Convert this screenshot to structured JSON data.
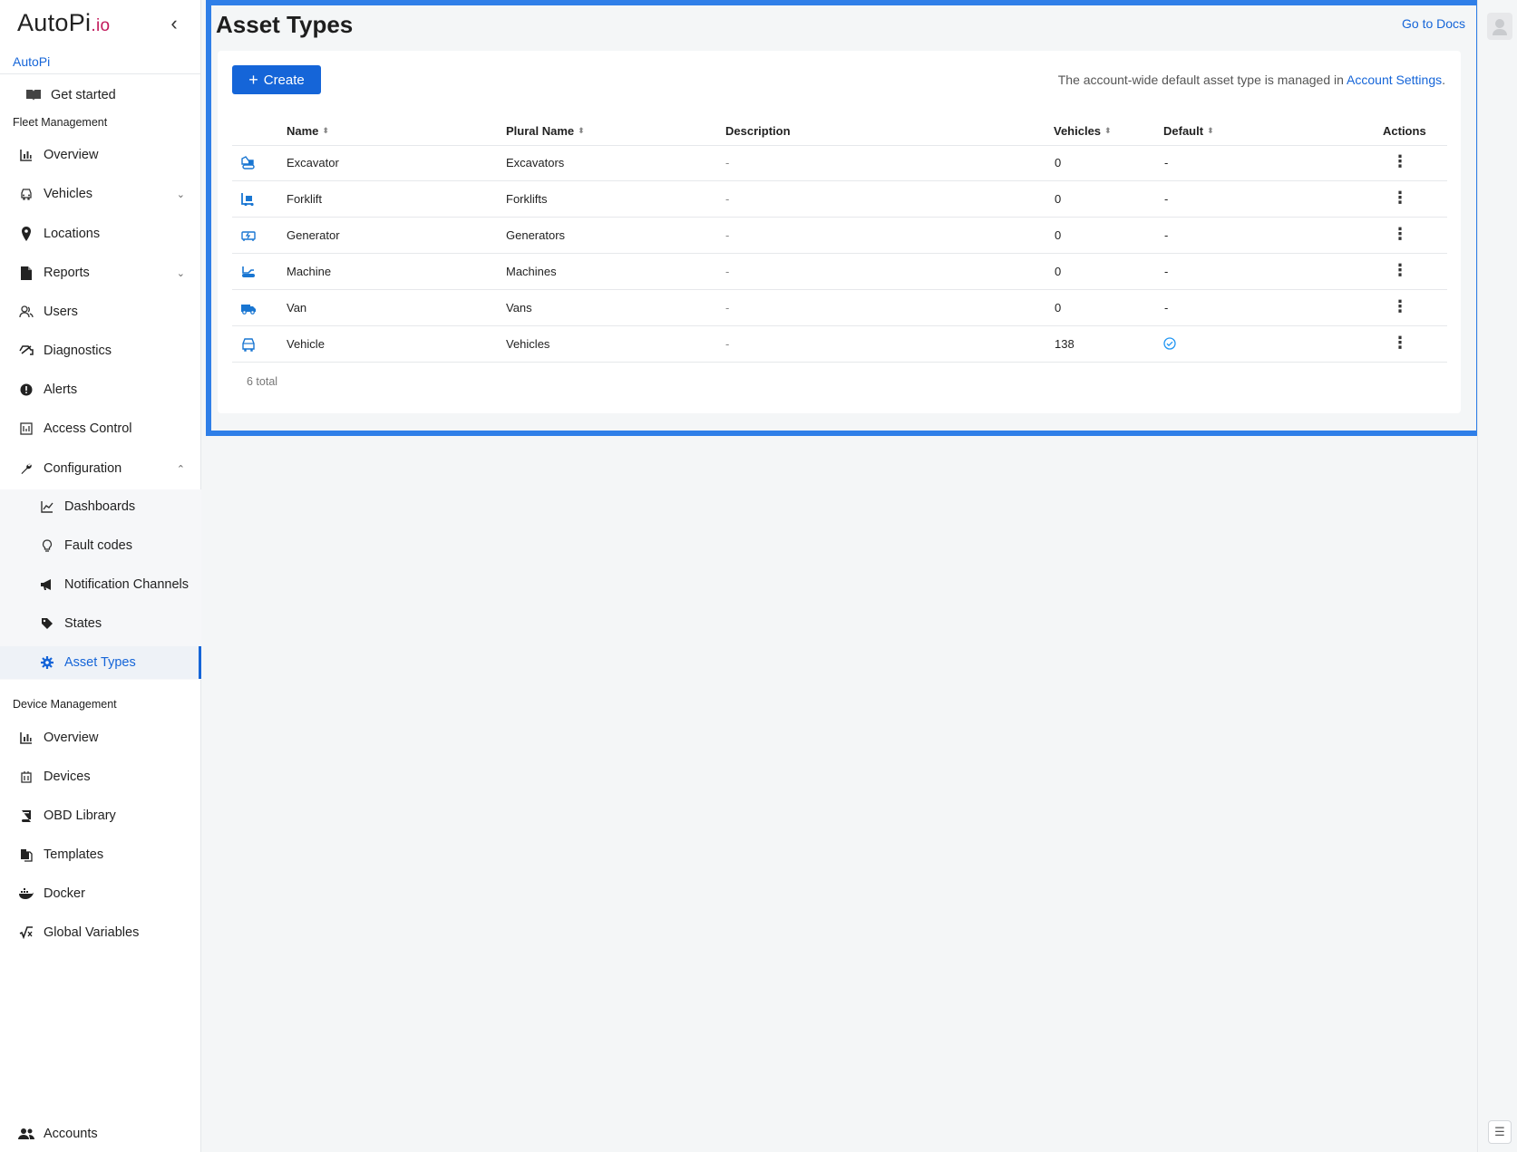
{
  "brand": {
    "name": "AutoPi",
    "suffix": ".io"
  },
  "sidebar": {
    "account": "AutoPi",
    "get_started": "Get started",
    "fleet_section": "Fleet Management",
    "fleet_items": [
      {
        "label": "Overview",
        "icon": "bar-chart-icon"
      },
      {
        "label": "Vehicles",
        "icon": "car-icon"
      },
      {
        "label": "Locations",
        "icon": "map-pin-icon"
      },
      {
        "label": "Reports",
        "icon": "document-icon"
      },
      {
        "label": "Users",
        "icon": "users-icon"
      },
      {
        "label": "Diagnostics",
        "icon": "diagnostics-icon"
      },
      {
        "label": "Alerts",
        "icon": "alert-icon"
      },
      {
        "label": "Access Control",
        "icon": "access-control-icon"
      },
      {
        "label": "Configuration",
        "icon": "wrench-icon"
      }
    ],
    "config_items": [
      {
        "label": "Dashboards",
        "icon": "line-chart-icon"
      },
      {
        "label": "Fault codes",
        "icon": "lightbulb-icon"
      },
      {
        "label": "Notification Channels",
        "icon": "megaphone-icon"
      },
      {
        "label": "States",
        "icon": "tag-icon"
      },
      {
        "label": "Asset Types",
        "icon": "gear-icon"
      }
    ],
    "device_section": "Device Management",
    "device_items": [
      {
        "label": "Overview",
        "icon": "bar-chart-icon"
      },
      {
        "label": "Devices",
        "icon": "devices-icon"
      },
      {
        "label": "OBD Library",
        "icon": "book-icon"
      },
      {
        "label": "Templates",
        "icon": "templates-icon"
      },
      {
        "label": "Docker",
        "icon": "docker-icon"
      },
      {
        "label": "Global Variables",
        "icon": "sqrt-icon"
      }
    ],
    "accounts": "Accounts"
  },
  "main": {
    "title": "Asset Types",
    "docs_link": "Go to Docs",
    "create_label": "Create",
    "notice_prefix": "The account-wide default asset type is managed in ",
    "notice_link": "Account Settings",
    "notice_suffix": ".",
    "columns": {
      "name": "Name",
      "plural": "Plural Name",
      "description": "Description",
      "vehicles": "Vehicles",
      "default": "Default",
      "actions": "Actions"
    },
    "rows": [
      {
        "icon": "excavator-icon",
        "name": "Excavator",
        "plural": "Excavators",
        "description": "-",
        "vehicles": "0",
        "default": "-"
      },
      {
        "icon": "forklift-icon",
        "name": "Forklift",
        "plural": "Forklifts",
        "description": "-",
        "vehicles": "0",
        "default": "-"
      },
      {
        "icon": "generator-icon",
        "name": "Generator",
        "plural": "Generators",
        "description": "-",
        "vehicles": "0",
        "default": "-"
      },
      {
        "icon": "machine-icon",
        "name": "Machine",
        "plural": "Machines",
        "description": "-",
        "vehicles": "0",
        "default": "-"
      },
      {
        "icon": "van-icon",
        "name": "Van",
        "plural": "Vans",
        "description": "-",
        "vehicles": "0",
        "default": "-"
      },
      {
        "icon": "vehicle-icon",
        "name": "Vehicle",
        "plural": "Vehicles",
        "description": "-",
        "vehicles": "138",
        "default": "check"
      }
    ],
    "total": "6 total"
  },
  "colors": {
    "accent": "#1565d8",
    "frame": "#2f7fe8"
  }
}
